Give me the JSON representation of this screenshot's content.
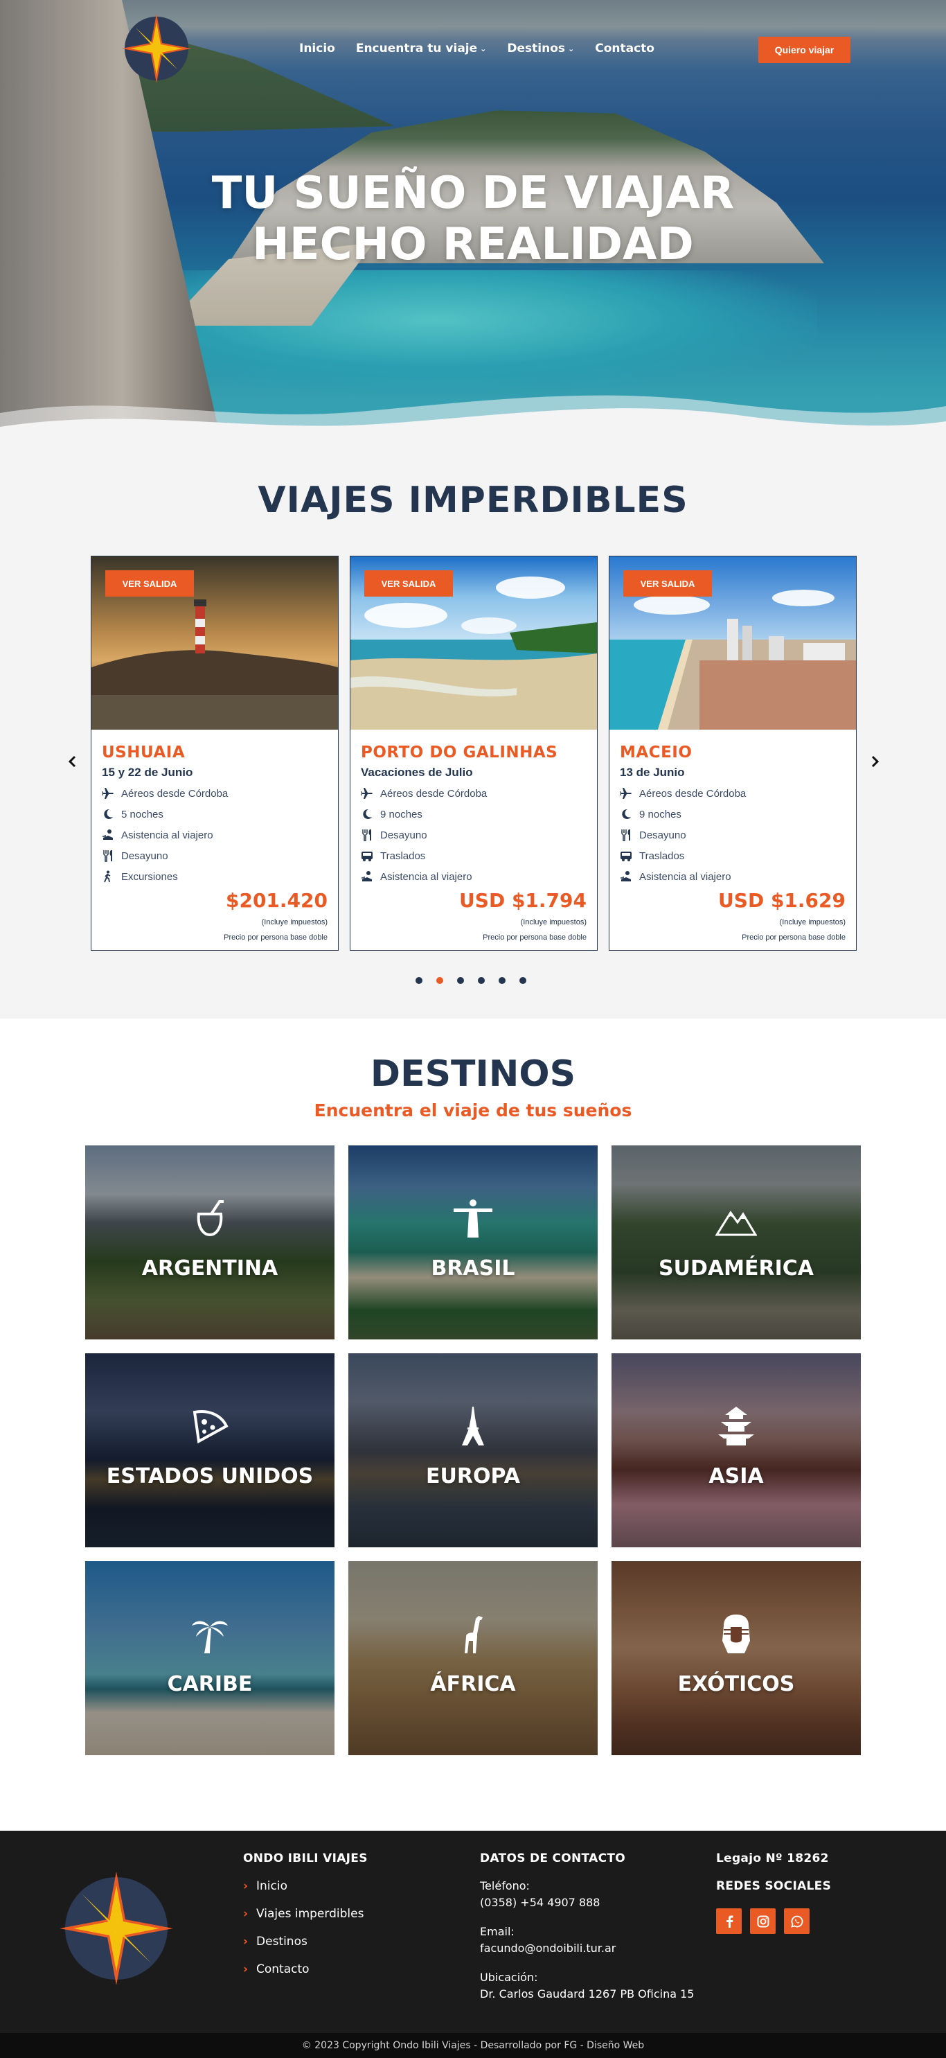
{
  "colors": {
    "accent": "#ea5a24",
    "navy": "#243550",
    "footer_bg": "#1b1b1b"
  },
  "nav": {
    "items": [
      {
        "label": "Inicio",
        "has_dropdown": false
      },
      {
        "label": "Encuentra tu viaje",
        "has_dropdown": true
      },
      {
        "label": "Destinos",
        "has_dropdown": true
      },
      {
        "label": "Contacto",
        "has_dropdown": false
      }
    ],
    "cta_label": "Quiero viajar"
  },
  "hero": {
    "line1": "TU SUEÑO DE VIAJAR",
    "line2": "HECHO REALIDAD"
  },
  "viajes": {
    "title": "VIAJES IMPERDIBLES",
    "prev_icon": "chevron-left-icon",
    "next_icon": "chevron-right-icon",
    "cards": [
      {
        "badge": "VER SALIDA",
        "destination": "USHUAIA",
        "date": "15 y 22 de Junio",
        "features": [
          {
            "icon": "plane-icon",
            "text": "Aéreos desde Córdoba"
          },
          {
            "icon": "moon-icon",
            "text": "5 noches"
          },
          {
            "icon": "travel-assistance-icon",
            "text": "Asistencia al viajero"
          },
          {
            "icon": "utensils-icon",
            "text": "Desayuno"
          },
          {
            "icon": "hiking-icon",
            "text": "Excursiones"
          }
        ],
        "price": "$201.420",
        "tax_note": "(Incluye impuestos)",
        "per_person": "Precio por persona base doble"
      },
      {
        "badge": "VER SALIDA",
        "destination": "PORTO DO GALINHAS",
        "date": "Vacaciones de Julio",
        "features": [
          {
            "icon": "plane-icon",
            "text": "Aéreos desde Córdoba"
          },
          {
            "icon": "moon-icon",
            "text": "9 noches"
          },
          {
            "icon": "utensils-icon",
            "text": "Desayuno"
          },
          {
            "icon": "bus-icon",
            "text": "Traslados"
          },
          {
            "icon": "travel-assistance-icon",
            "text": "Asistencia al viajero"
          }
        ],
        "price": "USD $1.794",
        "tax_note": "(Incluye impuestos)",
        "per_person": "Precio por persona base doble"
      },
      {
        "badge": "VER SALIDA",
        "destination": "MACEIO",
        "date": "13 de Junio",
        "features": [
          {
            "icon": "plane-icon",
            "text": "Aéreos desde Córdoba"
          },
          {
            "icon": "moon-icon",
            "text": "9 noches"
          },
          {
            "icon": "utensils-icon",
            "text": "Desayuno"
          },
          {
            "icon": "bus-icon",
            "text": "Traslados"
          },
          {
            "icon": "travel-assistance-icon",
            "text": "Asistencia al viajero"
          }
        ],
        "price": "USD $1.629",
        "tax_note": "(Incluye impuestos)",
        "per_person": "Precio por persona base doble"
      }
    ],
    "carousel": {
      "total": 6,
      "active": 2
    }
  },
  "destinos": {
    "title": "DESTINOS",
    "subtitle": "Encuentra el viaje de tus sueños",
    "tiles": [
      {
        "name": "ARGENTINA",
        "icon": "mate-icon"
      },
      {
        "name": "BRASIL",
        "icon": "christ-redeemer-icon"
      },
      {
        "name": "SUDAMÉRICA",
        "icon": "mountains-icon"
      },
      {
        "name": "ESTADOS UNIDOS",
        "icon": "pizza-icon"
      },
      {
        "name": "EUROPA",
        "icon": "eiffel-tower-icon"
      },
      {
        "name": "ASIA",
        "icon": "pagoda-icon"
      },
      {
        "name": "CARIBE",
        "icon": "palm-tree-icon"
      },
      {
        "name": "ÁFRICA",
        "icon": "giraffe-icon"
      },
      {
        "name": "EXÓTICOS",
        "icon": "pharaoh-icon"
      }
    ]
  },
  "footer": {
    "col1": {
      "heading": "ONDO IBILI VIAJES",
      "links": [
        "Inicio",
        "Viajes imperdibles",
        "Destinos",
        "Contacto"
      ]
    },
    "col2": {
      "heading": "DATOS DE CONTACTO",
      "phone_label": "Teléfono:",
      "phone": "(0358) +54 4907 888",
      "email_label": "Email:",
      "email": "facundo@ondoibili.tur.ar",
      "location_label": "Ubicación:",
      "location": "Dr. Carlos Gaudard 1267 PB Oficina 15"
    },
    "col3": {
      "legajo": "Legajo Nº 18262",
      "social_heading": "REDES SOCIALES",
      "social": [
        "facebook-icon",
        "instagram-icon",
        "whatsapp-icon"
      ]
    },
    "copyright": "© 2023 Copyright Ondo Ibili Viajes - Desarrollado por FG - Diseño Web"
  }
}
